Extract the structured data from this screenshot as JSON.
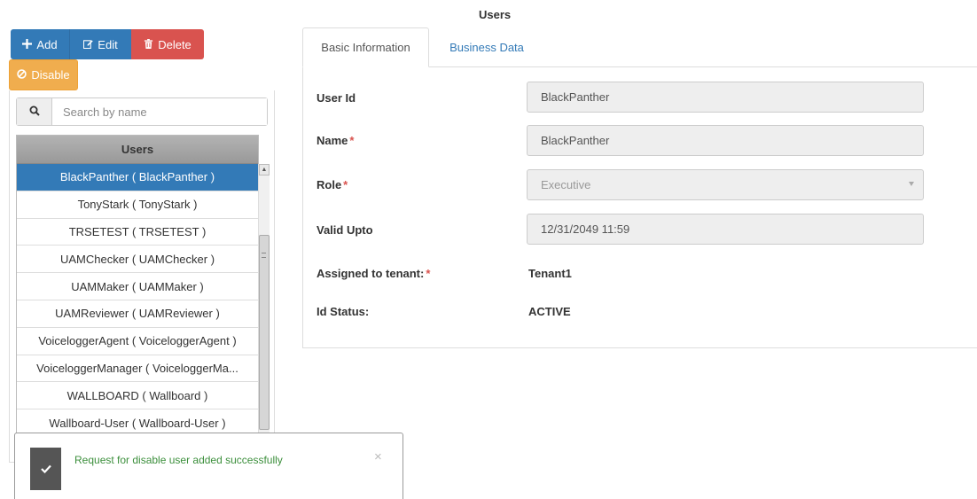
{
  "page": {
    "title": "Users"
  },
  "toolbar": {
    "add_label": "Add",
    "edit_label": "Edit",
    "delete_label": "Delete",
    "disable_label": "Disable",
    "colors": {
      "primary": "#337ab7",
      "danger": "#d9534f",
      "warning": "#f0ad4e"
    }
  },
  "search": {
    "placeholder": "Search by name",
    "value": ""
  },
  "user_list": {
    "header": "Users",
    "selected_index": 0,
    "items": [
      "BlackPanther ( BlackPanther )",
      "TonyStark ( TonyStark )",
      "TRSETEST ( TRSETEST )",
      "UAMChecker ( UAMChecker )",
      "UAMMaker ( UAMMaker )",
      "UAMReviewer ( UAMReviewer )",
      "VoiceloggerAgent ( VoiceloggerAgent )",
      "VoiceloggerManager ( VoiceloggerMa...",
      "WALLBOARD ( Wallboard )",
      "Wallboard-User ( Wallboard-User )"
    ]
  },
  "toast": {
    "message": "Request for disable user added successfully",
    "close": "×"
  },
  "tabs": [
    {
      "label": "Basic Information",
      "active": true
    },
    {
      "label": "Business Data",
      "active": false
    }
  ],
  "form": {
    "user_id": {
      "label": "User Id",
      "value": "BlackPanther"
    },
    "name": {
      "label": "Name",
      "required": "*",
      "value": "BlackPanther"
    },
    "role": {
      "label": "Role",
      "required": "*",
      "value": "Executive"
    },
    "valid_upto": {
      "label": "Valid Upto",
      "value": "12/31/2049 11:59"
    },
    "tenant": {
      "label": "Assigned to tenant:",
      "required": "*",
      "value": "Tenant1"
    },
    "id_status": {
      "label": "Id Status:",
      "value": "ACTIVE"
    }
  }
}
